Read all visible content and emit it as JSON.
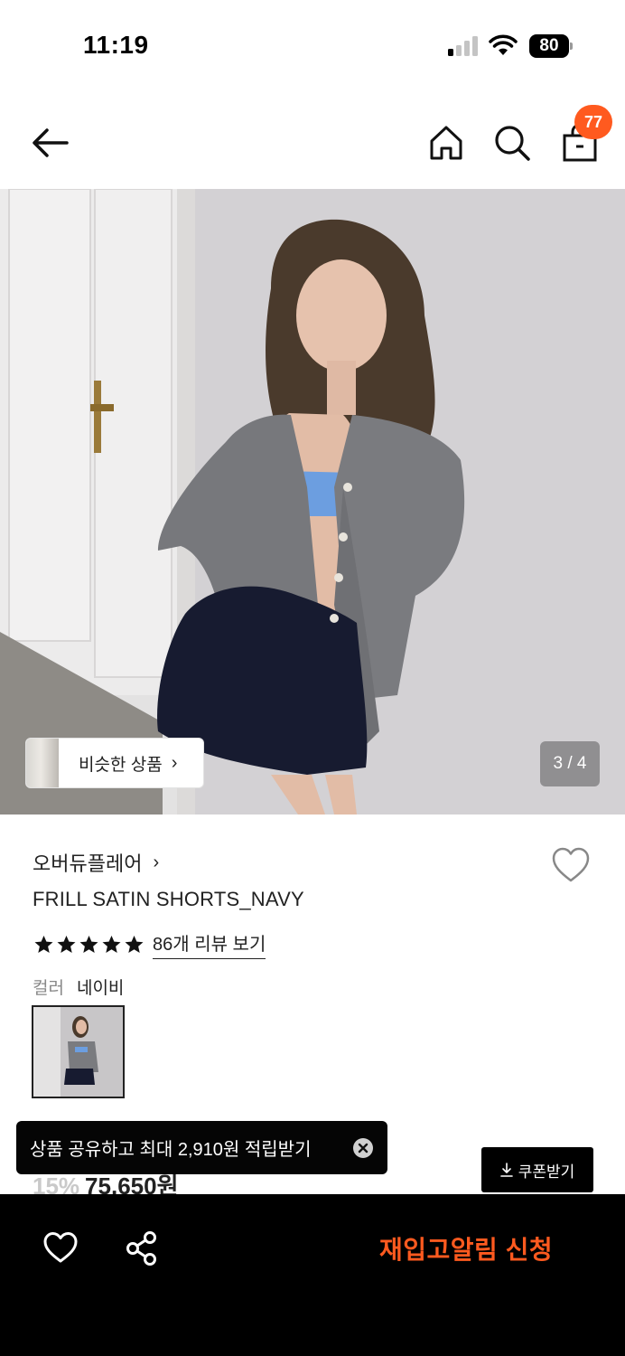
{
  "status_bar": {
    "time": "11:19",
    "battery": "80"
  },
  "header": {
    "cart_count": "77"
  },
  "gallery": {
    "similar_label": "비슷한 상품",
    "page_indicator": "3 / 4"
  },
  "product": {
    "brand": "오버듀플레어",
    "title": "FRILL SATIN SHORTS_NAVY",
    "rating": 5,
    "review_link": "86개 리뷰 보기",
    "color_label": "컬러",
    "color_value": "네이비",
    "discount": "15%",
    "price": "75,650원"
  },
  "toast": {
    "text": "상품 공유하고 최대 2,910원 적립받기"
  },
  "coupon": {
    "label": "쿠폰받기"
  },
  "bottom_bar": {
    "restock_label": "재입고알림 신청"
  },
  "colors": {
    "accent": "#ff5a1f",
    "dark": "#000000"
  },
  "icons": [
    "back-arrow-icon",
    "home-icon",
    "search-icon",
    "shopping-bag-icon",
    "heart-icon",
    "share-icon",
    "close-icon",
    "download-icon",
    "star-icon",
    "chevron-right-icon"
  ]
}
